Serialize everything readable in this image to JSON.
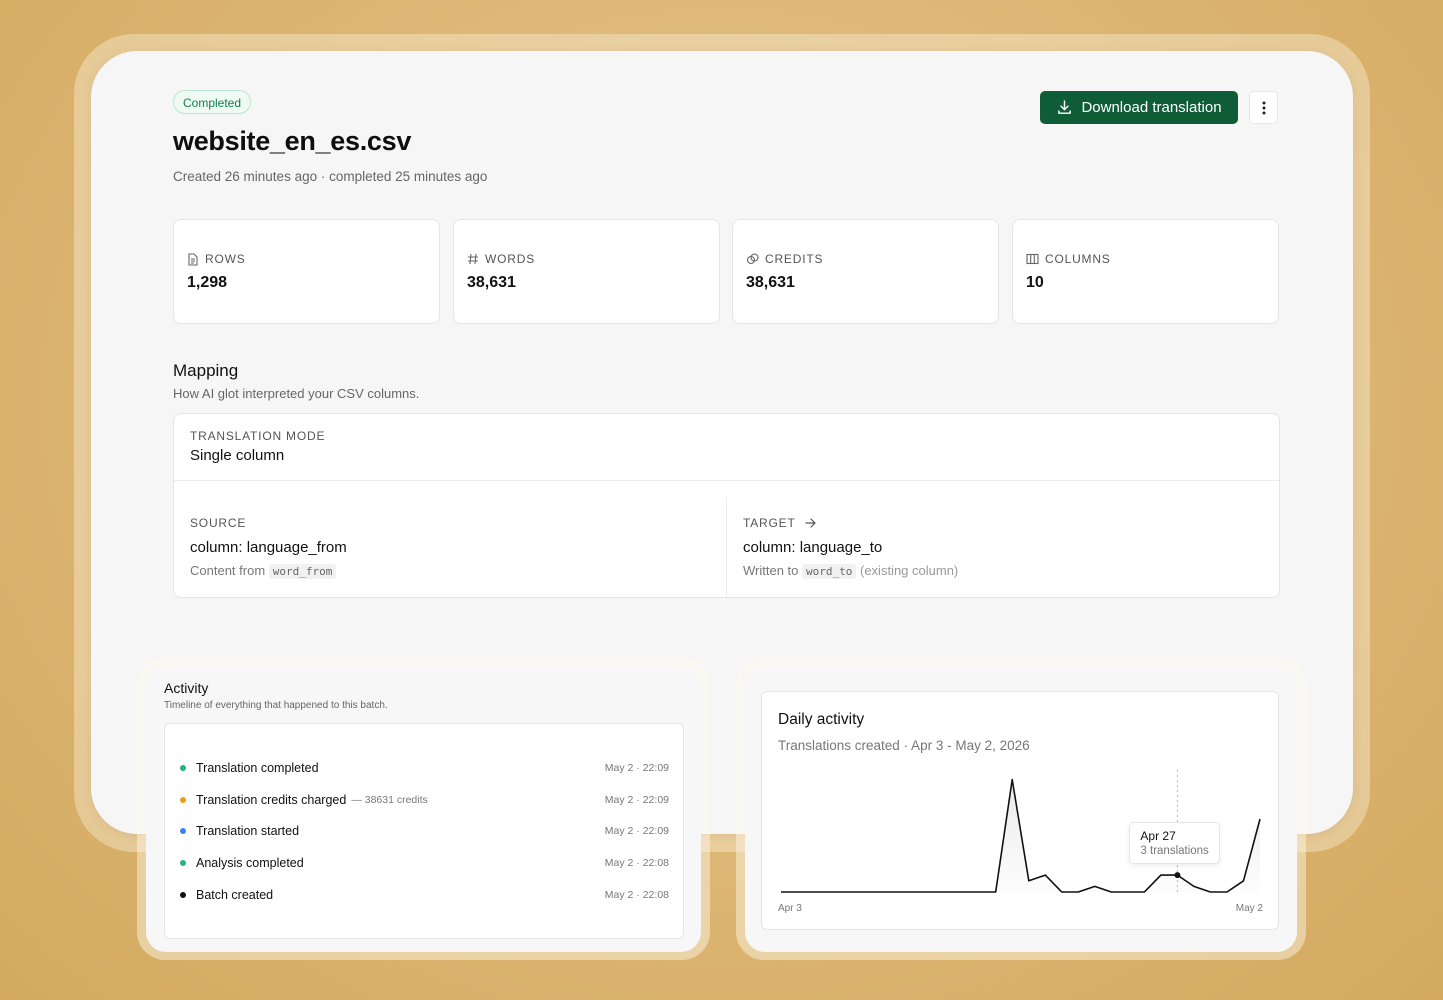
{
  "header": {
    "status_badge": "Completed",
    "file_name": "website_en_es.csv",
    "meta": "Created 26 minutes ago · completed 25 minutes ago",
    "download_label": "Download translation"
  },
  "stats": [
    {
      "label": "ROWS",
      "value": "1,298",
      "icon": "document-icon"
    },
    {
      "label": "WORDS",
      "value": "38,631",
      "icon": "hash-icon"
    },
    {
      "label": "CREDITS",
      "value": "38,631",
      "icon": "coins-icon"
    },
    {
      "label": "COLUMNS",
      "value": "10",
      "icon": "columns-icon"
    }
  ],
  "mapping": {
    "title": "Mapping",
    "subtitle": "How AI glot interpreted your CSV columns.",
    "mode_label": "TRANSLATION MODE",
    "mode_value": "Single column",
    "source": {
      "label": "SOURCE",
      "value": "column: language_from",
      "note_prefix": "Content from",
      "code": "word_from"
    },
    "target": {
      "label": "TARGET",
      "value": "column: language_to",
      "note_prefix": "Written to",
      "code": "word_to",
      "note_suffix": "(existing column)"
    }
  },
  "activity": {
    "title": "Activity",
    "subtitle": "Timeline of everything that happened to this batch.",
    "items": [
      {
        "label": "Translation completed",
        "extra": "",
        "time": "May 2 · 22:09",
        "color": "#1fb877"
      },
      {
        "label": "Translation credits charged",
        "extra": "— 38631 credits",
        "time": "May 2 · 22:09",
        "color": "#f29b19"
      },
      {
        "label": "Translation started",
        "extra": "",
        "time": "May 2 · 22:09",
        "color": "#3b82f6"
      },
      {
        "label": "Analysis completed",
        "extra": "",
        "time": "May 2 · 22:08",
        "color": "#1fb877"
      },
      {
        "label": "Batch created",
        "extra": "",
        "time": "May 2 · 22:08",
        "color": "#111111"
      }
    ]
  },
  "daily": {
    "title": "Daily activity",
    "subtitle": "Translations created · Apr 3 - May 2, 2026",
    "x_start_label": "Apr 3",
    "x_end_label": "May 2",
    "tooltip": {
      "date": "Apr 27",
      "value": "3 translations"
    }
  },
  "chart_data": {
    "type": "line",
    "title": "Daily activity",
    "x": [
      "Apr 3",
      "Apr 4",
      "Apr 5",
      "Apr 6",
      "Apr 7",
      "Apr 8",
      "Apr 9",
      "Apr 10",
      "Apr 11",
      "Apr 12",
      "Apr 13",
      "Apr 14",
      "Apr 15",
      "Apr 16",
      "Apr 17",
      "Apr 18",
      "Apr 19",
      "Apr 20",
      "Apr 21",
      "Apr 22",
      "Apr 23",
      "Apr 24",
      "Apr 25",
      "Apr 26",
      "Apr 27",
      "Apr 28",
      "Apr 29",
      "Apr 30",
      "May 1",
      "May 2"
    ],
    "series": [
      {
        "values": [
          0,
          0,
          0,
          0,
          0,
          0,
          0,
          0,
          0,
          0,
          0,
          0,
          0,
          0,
          20,
          2,
          3,
          0,
          0,
          1,
          0,
          0,
          0,
          3,
          3,
          1,
          0,
          0,
          2,
          13
        ]
      }
    ],
    "ylim": [
      0,
      21
    ],
    "grid": false,
    "highlight": {
      "x": "Apr 27",
      "value": 3
    }
  }
}
